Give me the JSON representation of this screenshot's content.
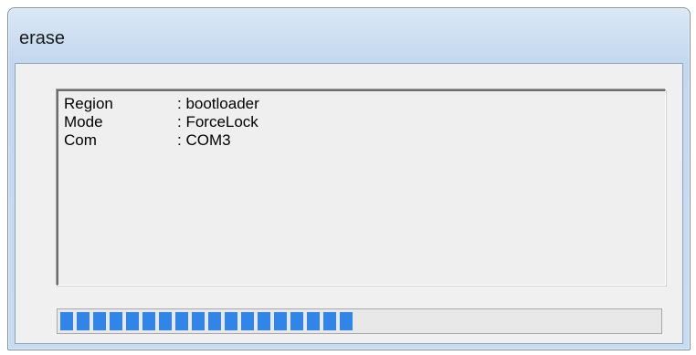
{
  "window": {
    "title": "erase"
  },
  "log": {
    "lines": [
      {
        "key": "Region",
        "value": ": bootloader"
      },
      {
        "key": "Mode",
        "value": ": ForceLock"
      },
      {
        "key": "Com",
        "value": ": COM3"
      }
    ]
  },
  "progress": {
    "fraction": 0.5,
    "color": "#2f86e8"
  }
}
